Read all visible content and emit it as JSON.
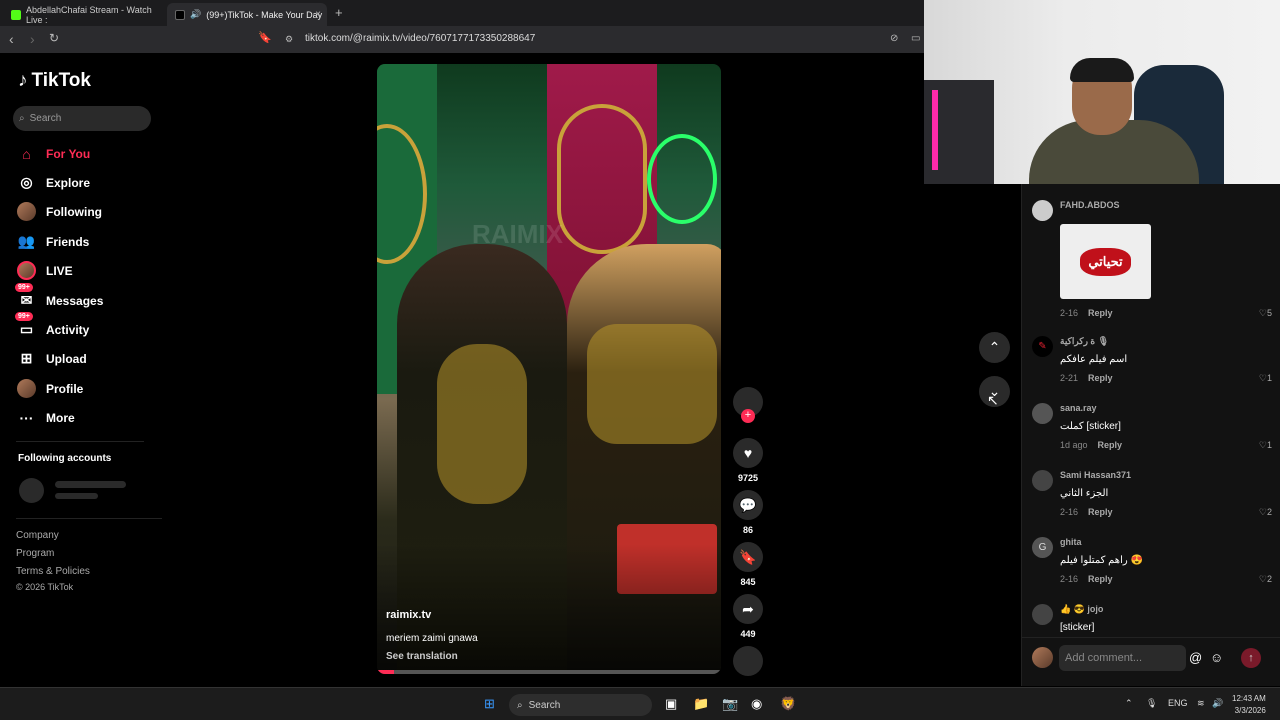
{
  "browser": {
    "tabs": [
      {
        "title": "AbdellahChafai Stream - Watch Live :"
      },
      {
        "title": "(99+)TikTok - Make Your Day",
        "close": "×"
      }
    ],
    "new_tab": "+",
    "url": "tiktok.com/@raimix.tv/video/7607177173350288647"
  },
  "sidebar": {
    "logo": "TikTok",
    "search_placeholder": "Search",
    "nav": [
      {
        "label": "For You"
      },
      {
        "label": "Explore"
      },
      {
        "label": "Following"
      },
      {
        "label": "Friends"
      },
      {
        "label": "LIVE"
      },
      {
        "label": "Messages",
        "badge": "99+"
      },
      {
        "label": "Activity",
        "badge": "99+"
      },
      {
        "label": "Upload"
      },
      {
        "label": "Profile"
      },
      {
        "label": "More"
      }
    ],
    "following_header": "Following accounts",
    "footer": [
      "Company",
      "Program",
      "Terms & Policies",
      "© 2026 TikTok"
    ]
  },
  "video": {
    "watermark": "RAIMIX",
    "author": "raimix.tv",
    "description": "meriem zaimi gnawa",
    "see_translation": "See translation",
    "progress": 0.05
  },
  "actions": {
    "likes": "9725",
    "comments": "86",
    "saves": "845",
    "shares": "449"
  },
  "comments": [
    {
      "user": "FAHD.ABDOS",
      "text": "",
      "sticker": "تحياتي",
      "date": "2-16",
      "reply": "Reply",
      "likes": "5"
    },
    {
      "user": "ة ركراكية 🎙",
      "text": "اسم فيلم عافكم",
      "date": "2-21",
      "reply": "Reply",
      "likes": "1"
    },
    {
      "user": "sana.ray",
      "text": "كملت [sticker]",
      "date": "1d ago",
      "reply": "Reply",
      "likes": "1"
    },
    {
      "user": "Sami Hassan371",
      "text": "الجزء الثاني",
      "date": "2-16",
      "reply": "Reply",
      "likes": "2"
    },
    {
      "user": "ghita",
      "avatar_letter": "G",
      "text": "راهم كمتلوا فيلم 😍",
      "date": "2-16",
      "reply": "Reply",
      "likes": "2"
    },
    {
      "user": "👍 😎 jojo",
      "text": "[sticker]"
    }
  ],
  "add_comment": {
    "placeholder": "Add comment..."
  },
  "taskbar": {
    "search": "Search",
    "lang": "ENG",
    "time": "12:43 AM",
    "date": "3/3/2026"
  },
  "colors": {
    "accent": "#fe2c55",
    "bg": "#000000",
    "panel": "#121212"
  }
}
